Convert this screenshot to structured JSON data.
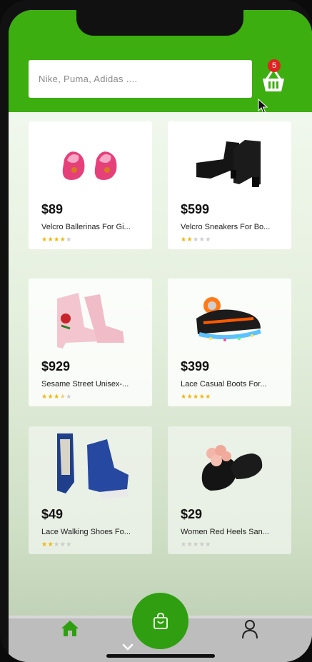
{
  "search": {
    "placeholder": "Nike, Puma, Adidas ...."
  },
  "cart": {
    "count": "5",
    "icon": "basket-icon"
  },
  "colors": {
    "brand": "#3cae0f",
    "fab": "#2f9f11",
    "badge": "#e32222",
    "star": "#f2b400"
  },
  "products": [
    {
      "price": "$89",
      "name": "Velcro Ballerinas For Gi...",
      "rating": 4,
      "image": "pink-ballerina-shoes"
    },
    {
      "price": "$599",
      "name": "Velcro Sneakers For Bo...",
      "rating": 2,
      "image": "black-heeled-boots"
    },
    {
      "price": "$929",
      "name": "Sesame Street Unisex-...",
      "rating": 3.5,
      "image": "pink-floral-boots"
    },
    {
      "price": "$399",
      "name": "Lace Casual Boots For...",
      "rating": 5,
      "image": "light-up-roller-sneaker"
    },
    {
      "price": "$49",
      "name": "Lace Walking Shoes Fo...",
      "rating": 2,
      "image": "blue-denim-boots"
    },
    {
      "price": "$29",
      "name": "Women Red Heels San...",
      "rating": 0,
      "image": "black-flower-sandals"
    }
  ],
  "tabs": [
    {
      "icon": "home-icon",
      "active": true
    },
    {
      "icon": "shopping-bag-icon",
      "active": false
    },
    {
      "icon": "profile-icon",
      "active": false
    }
  ]
}
